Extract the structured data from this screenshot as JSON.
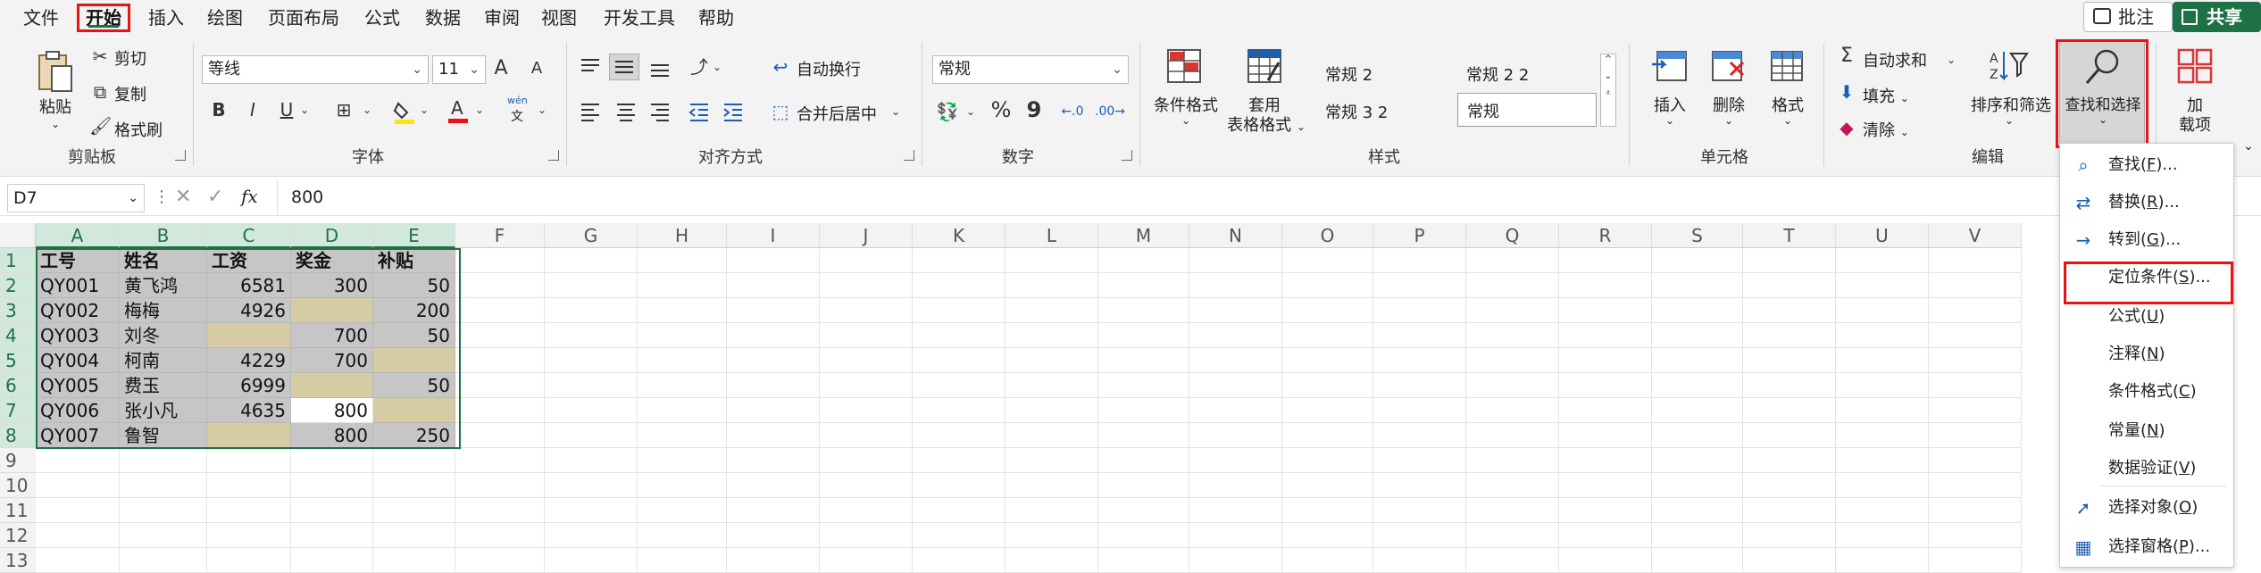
{
  "menu": {
    "items": [
      "文件",
      "开始",
      "插入",
      "绘图",
      "页面布局",
      "公式",
      "数据",
      "审阅",
      "视图",
      "开发工具",
      "帮助"
    ],
    "active": "开始",
    "comment_label": "批注",
    "share_label": "共享"
  },
  "ribbon": {
    "clipboard": {
      "group_label": "剪贴板",
      "paste": "粘贴",
      "cut": "剪切",
      "copy": "复制",
      "format_painter": "格式刷"
    },
    "font": {
      "group_label": "字体",
      "font_name": "等线",
      "font_size": "11",
      "bold": "B",
      "italic": "I",
      "underline": "U",
      "grow": "A",
      "shrink": "A",
      "wen": "wén",
      "wen_char": "文"
    },
    "alignment": {
      "group_label": "对齐方式",
      "wrap": "自动换行",
      "merge": "合并后居中"
    },
    "number": {
      "group_label": "数字",
      "format": "常规",
      "percent": "%",
      "comma": "9"
    },
    "styles": {
      "group_label": "样式",
      "conditional": "条件格式",
      "table_line1": "套用",
      "table_line2": "表格格式",
      "style1": "常规 2",
      "style2": "常规 2 2",
      "style3": "常规 3 2",
      "style4": "常规"
    },
    "cells": {
      "group_label": "单元格",
      "insert": "插入",
      "delete": "删除",
      "format": "格式"
    },
    "editing": {
      "group_label": "编辑",
      "autosum": "自动求和",
      "fill": "填充",
      "clear": "清除",
      "sort": "排序和筛选",
      "find": "查找和选择"
    },
    "addins": {
      "line1": "加",
      "line2": "载项"
    }
  },
  "formula_bar": {
    "name_box": "D7",
    "fx": "fx",
    "value": "800"
  },
  "sheet": {
    "columns": [
      "A",
      "B",
      "C",
      "D",
      "E",
      "F",
      "G",
      "H",
      "I",
      "J",
      "K",
      "L",
      "M",
      "N",
      "O",
      "P",
      "Q",
      "R",
      "S",
      "T",
      "U",
      "V"
    ],
    "rows": [
      "1",
      "2",
      "3",
      "4",
      "5",
      "6",
      "7",
      "8",
      "9",
      "10",
      "11",
      "12",
      "13"
    ],
    "headers": [
      "工号",
      "姓名",
      "工资",
      "奖金",
      "补贴"
    ],
    "data": [
      [
        "QY001",
        "黄飞鸿",
        "6581",
        "300",
        "50"
      ],
      [
        "QY002",
        "梅梅",
        "4926",
        "",
        "200"
      ],
      [
        "QY003",
        "刘冬",
        "",
        "700",
        "50"
      ],
      [
        "QY004",
        "柯南",
        "4229",
        "700",
        ""
      ],
      [
        "QY005",
        "费玉",
        "6999",
        "",
        "50"
      ],
      [
        "QY006",
        "张小凡",
        "4635",
        "800",
        ""
      ],
      [
        "QY007",
        "鲁智",
        "",
        "800",
        "250"
      ]
    ]
  },
  "dropdown": {
    "items": [
      {
        "label": "查找(",
        "key": "F",
        "suffix": ")...",
        "icon": "search-icon"
      },
      {
        "label": "替换(",
        "key": "R",
        "suffix": ")...",
        "icon": "replace-icon"
      },
      {
        "label": "转到(",
        "key": "G",
        "suffix": ")...",
        "icon": "arrow-right-icon"
      },
      {
        "label": "定位条件(",
        "key": "S",
        "suffix": ")...",
        "icon": ""
      },
      {
        "label": "公式(",
        "key": "U",
        "suffix": ")",
        "icon": ""
      },
      {
        "label": "注释(",
        "key": "N",
        "suffix": ")",
        "icon": ""
      },
      {
        "label": "条件格式(",
        "key": "C",
        "suffix": ")",
        "icon": ""
      },
      {
        "label": "常量(",
        "key": "N",
        "suffix": ")",
        "icon": ""
      },
      {
        "label": "数据验证(",
        "key": "V",
        "suffix": ")",
        "icon": ""
      },
      {
        "label": "选择对象(",
        "key": "O",
        "suffix": ")",
        "icon": "cursor-icon"
      },
      {
        "label": "选择窗格(",
        "key": "P",
        "suffix": ")...",
        "icon": "pane-icon"
      }
    ]
  }
}
